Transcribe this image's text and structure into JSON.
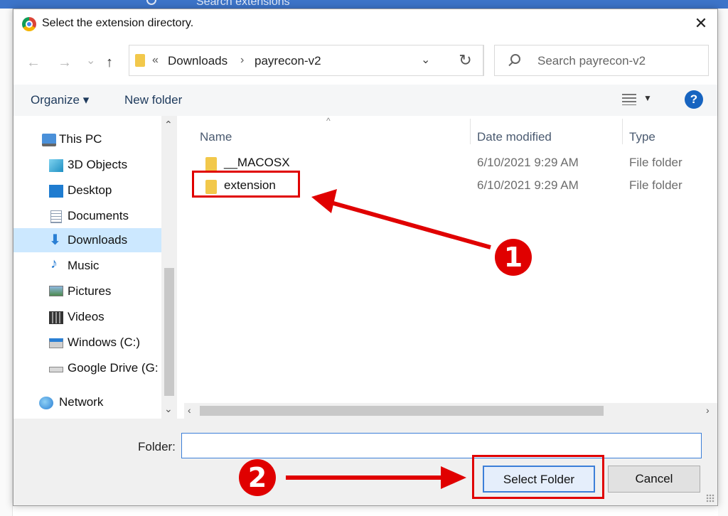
{
  "background": {
    "search_text": "Search extensions"
  },
  "dialog": {
    "title": "Select the extension directory.",
    "close_glyph": "✕"
  },
  "address": {
    "back": "←",
    "forward": "→",
    "recent": "⌄",
    "up": "↑",
    "overflow": "«",
    "crumbs": [
      "Downloads",
      "payrecon-v2"
    ],
    "crumb_sep": "›",
    "dropdown": "⌄",
    "refresh": "↻",
    "search_placeholder": "Search payrecon-v2"
  },
  "toolbar": {
    "organize": "Organize ▾",
    "new_folder": "New folder",
    "view_dd": "▼",
    "help": "?"
  },
  "nav": {
    "items": [
      {
        "label": "This PC",
        "icon": "computer-icon"
      },
      {
        "label": "3D Objects",
        "icon": "cube-icon"
      },
      {
        "label": "Desktop",
        "icon": "desktop-icon"
      },
      {
        "label": "Documents",
        "icon": "documents-icon"
      },
      {
        "label": "Downloads",
        "icon": "download-icon",
        "selected": true
      },
      {
        "label": "Music",
        "icon": "music-icon"
      },
      {
        "label": "Pictures",
        "icon": "pictures-icon"
      },
      {
        "label": "Videos",
        "icon": "videos-icon"
      },
      {
        "label": "Windows (C:)",
        "icon": "drive-icon"
      },
      {
        "label": "Google Drive (G:",
        "icon": "drive-icon"
      },
      {
        "label": "Network",
        "icon": "network-icon"
      }
    ]
  },
  "list": {
    "columns": {
      "name": "Name",
      "date": "Date modified",
      "type": "Type"
    },
    "sort_glyph": "^",
    "rows": [
      {
        "name": "__MACOSX",
        "date": "6/10/2021 9:29 AM",
        "type": "File folder"
      },
      {
        "name": "extension",
        "date": "6/10/2021 9:29 AM",
        "type": "File folder"
      }
    ]
  },
  "footer": {
    "folder_label": "Folder:",
    "folder_value": "",
    "select_button": "Select Folder",
    "cancel_button": "Cancel"
  },
  "annotations": {
    "step1": "1",
    "step2": "2",
    "color": "#e00000"
  }
}
